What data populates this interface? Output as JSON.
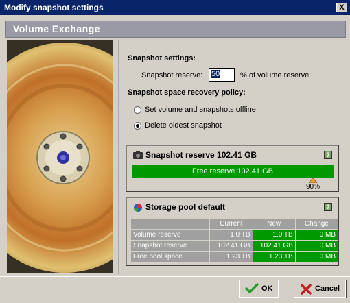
{
  "window": {
    "title": "Modify snapshot settings",
    "close_label": "X"
  },
  "header": {
    "title": "Volume Exchange"
  },
  "settings": {
    "section_title": "Snapshot settings:",
    "reserve_label": "Snapshot reserve:",
    "reserve_value": "50",
    "reserve_suffix": "% of volume reserve",
    "policy_title": "Snapshot space recovery policy:",
    "options": [
      {
        "label": "Set volume and snapshots offline",
        "selected": false
      },
      {
        "label": "Delete oldest snapshot",
        "selected": true
      }
    ]
  },
  "reserve_box": {
    "title": "Snapshot reserve 102.41 GB",
    "help": "?",
    "bar_label": "Free reserve 102.41 GB",
    "marker_label": "90%",
    "marker_fraction": 0.9
  },
  "pool_box": {
    "title": "Storage pool default",
    "help": "?",
    "columns": [
      "Current",
      "New",
      "Change"
    ],
    "rows": [
      {
        "label": "Volume reserve",
        "current": "1.0 TB",
        "new": "1.0 TB",
        "change": "0 MB"
      },
      {
        "label": "Snapshot reserve",
        "current": "102.41 GB",
        "new": "102.41 GB",
        "change": "0 MB"
      },
      {
        "label": "Free pool space",
        "current": "1.23 TB",
        "new": "1.23 TB",
        "change": "0 MB"
      }
    ]
  },
  "buttons": {
    "ok": "OK",
    "cancel": "Cancel"
  },
  "colors": {
    "title_bar": "#0a246a",
    "green": "#009900",
    "header": "#9a9aa6"
  }
}
